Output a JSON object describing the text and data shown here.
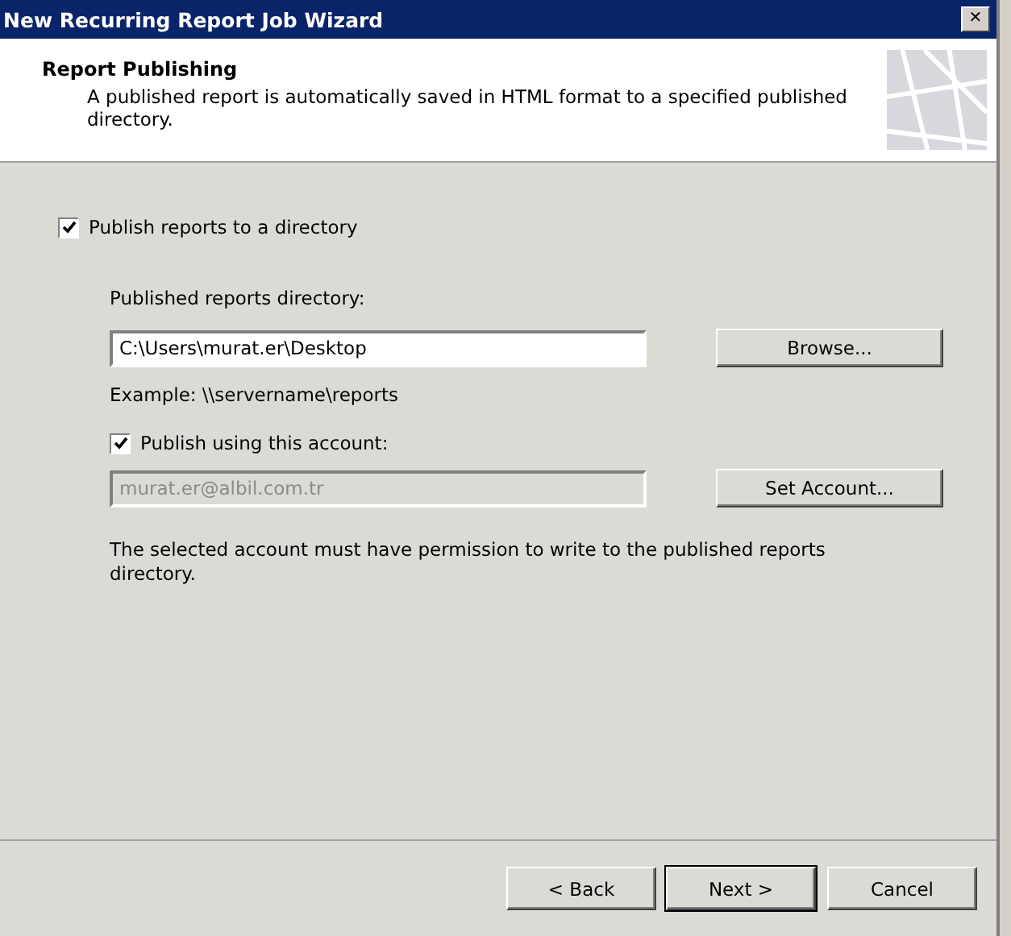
{
  "window": {
    "title": "New Recurring Report Job Wizard",
    "close_glyph": "✕"
  },
  "header": {
    "title": "Report Publishing",
    "description": "A published report is automatically saved in HTML format to a specified published directory."
  },
  "publish_checkbox": {
    "label": "Publish reports to a directory",
    "checked": true
  },
  "directory": {
    "label": "Published reports directory:",
    "value": "C:\\Users\\murat.er\\Desktop",
    "browse_button": "Browse...",
    "example": "Example: \\\\servername\\reports"
  },
  "account_checkbox": {
    "label": "Publish using this account:",
    "checked": true
  },
  "account": {
    "value": "murat.er@albil.com.tr",
    "disabled": true,
    "set_button": "Set Account..."
  },
  "note": "The selected account must have permission to write to the published reports directory.",
  "buttons": [
    {
      "label": "< Back",
      "default": false
    },
    {
      "label": "Next >",
      "default": true
    },
    {
      "label": "Cancel",
      "default": false
    }
  ]
}
